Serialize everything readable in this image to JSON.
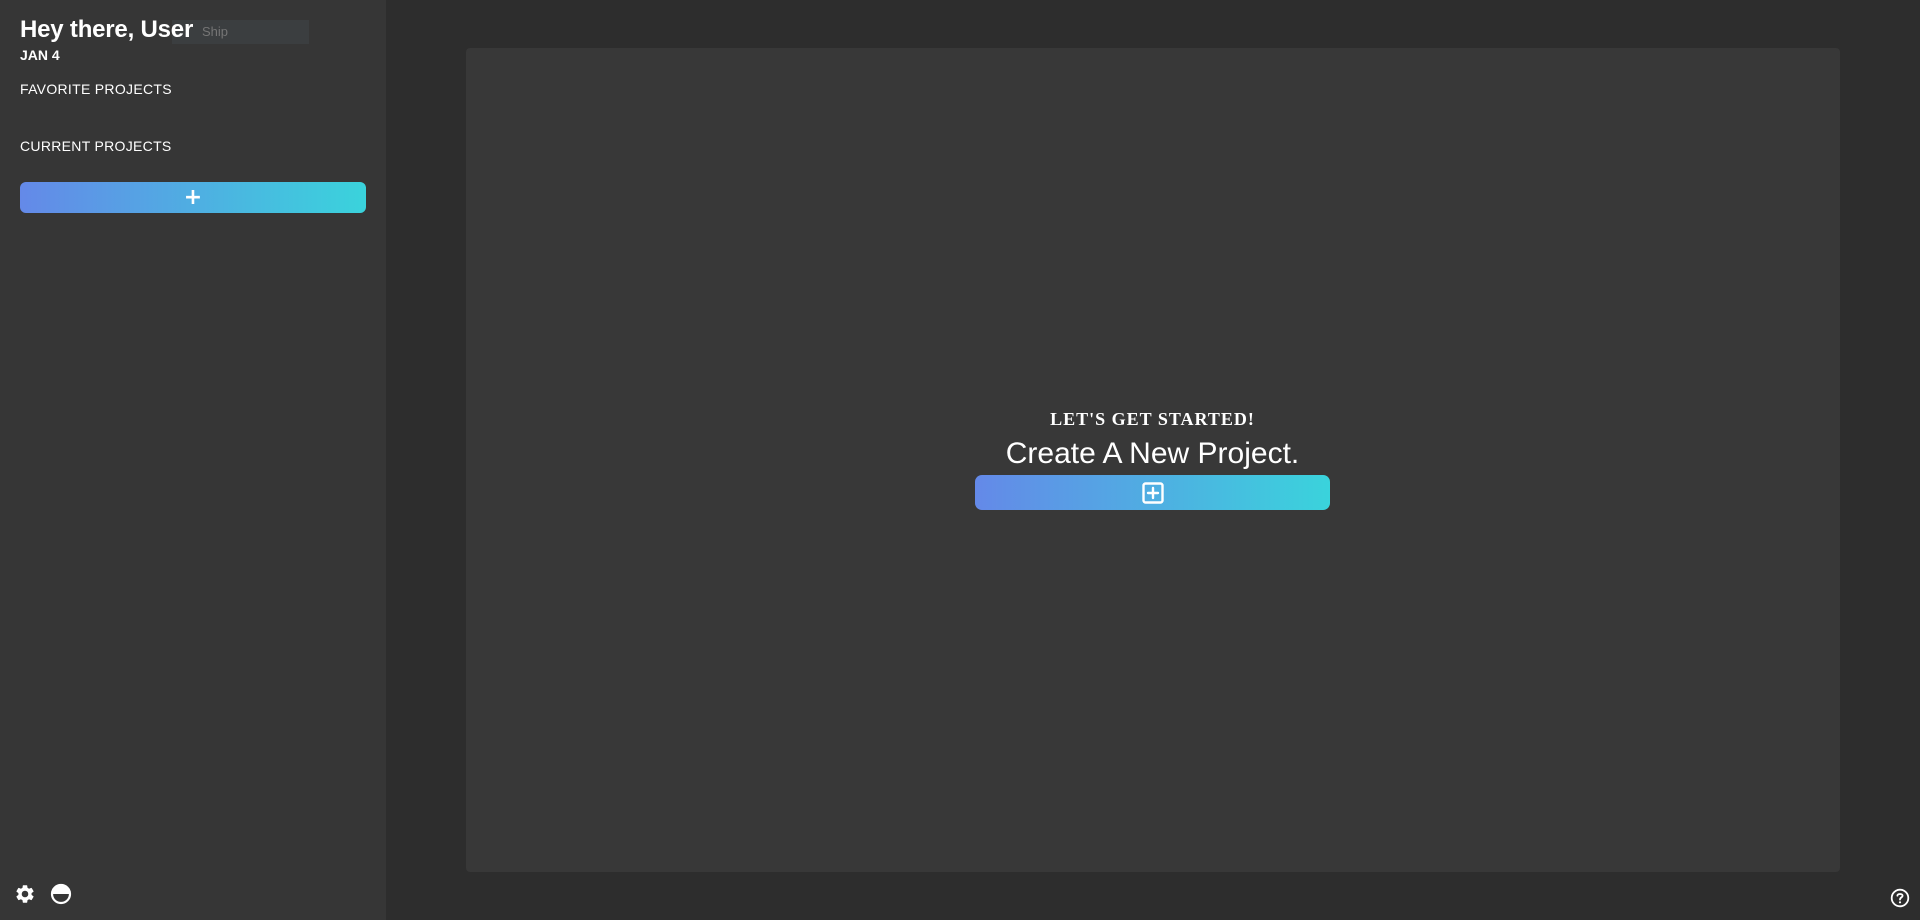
{
  "sidebar": {
    "greeting": "Hey there, User",
    "search_placeholder": "Ship",
    "date": "JAN 4",
    "favorites_label": "FAVORITE PROJECTS",
    "current_label": "CURRENT PROJECTS",
    "add_project_icon": "plus-icon",
    "footer_icons": [
      "gear-icon",
      "half-circle-theme-icon"
    ]
  },
  "main": {
    "kicker": "LET'S GET STARTED!",
    "title": "Create A New Project.",
    "create_icon": "plus-square-icon"
  },
  "help_icon": "question-circle-icon",
  "colors": {
    "gradient_start": "#6489e8",
    "gradient_end": "#3ad3dc",
    "sidebar_bg": "#363636",
    "app_bg": "#2d2d2d",
    "panel_bg": "#383838"
  }
}
